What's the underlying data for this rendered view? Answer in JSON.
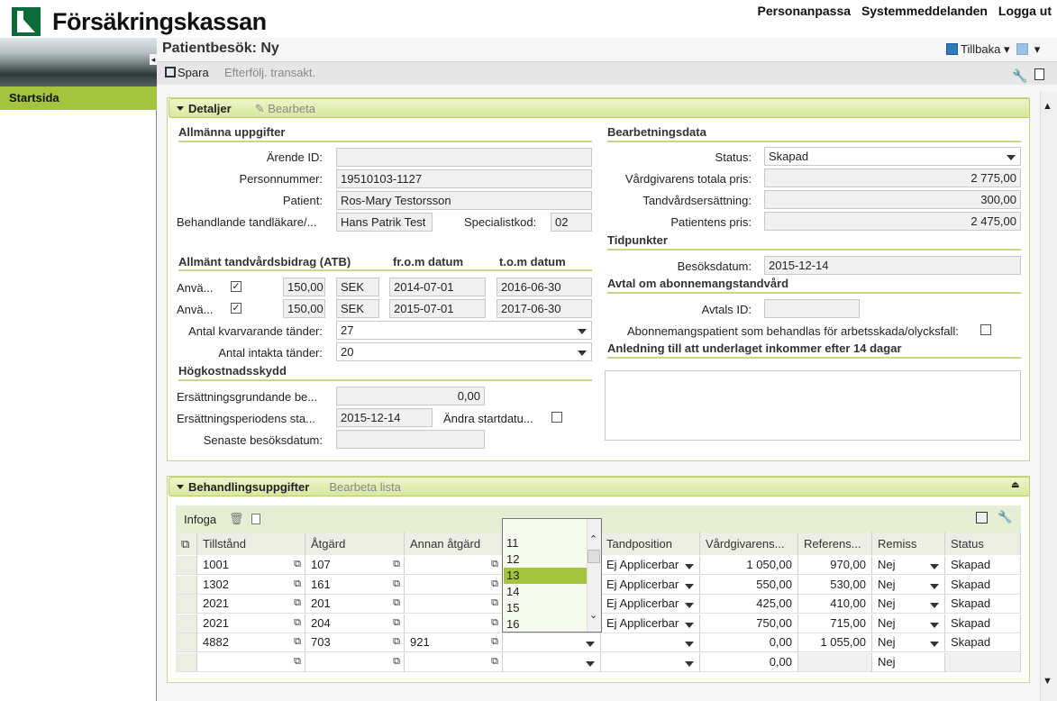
{
  "app": {
    "brand": "Försäkringskassan",
    "links": [
      "Personanpassa",
      "Systemmeddelanden",
      "Logga ut"
    ]
  },
  "nav": {
    "items": [
      {
        "label": "Startsida"
      }
    ]
  },
  "page": {
    "title": "Patientbesök: Ny",
    "back_label": "Tillbaka"
  },
  "toolbar": {
    "save_label": "Spara",
    "followup_label": "Efterfölj. transakt."
  },
  "details": {
    "header": "Detaljer",
    "edit_label": "Bearbeta",
    "general": {
      "title": "Allmänna uppgifter",
      "arende_label": "Ärende ID:",
      "arende_value": "",
      "pnr_label": "Personnummer:",
      "pnr_value": "19510103-1127",
      "patient_label": "Patient:",
      "patient_value": "Ros-Mary Testorsson",
      "dentist_label": "Behandlande tandläkare/...",
      "dentist_value": "Hans Patrik Test",
      "spec_label": "Specialistkod:",
      "spec_value": "02"
    },
    "atb": {
      "title": "Allmänt tandvårdsbidrag (ATB)",
      "from_header": "fr.o.m datum",
      "tom_header": "t.o.m datum",
      "rows": [
        {
          "label": "Anvä...",
          "checked": "✓",
          "amount": "150,00",
          "currency": "SEK",
          "from": "2014-07-01",
          "to": "2016-06-30"
        },
        {
          "label": "Anvä...",
          "checked": "✓",
          "amount": "150,00",
          "currency": "SEK",
          "from": "2015-07-01",
          "to": "2017-06-30"
        }
      ],
      "remaining_label": "Antal kvarvarande tänder:",
      "remaining_value": "27",
      "intact_label": "Antal intakta tänder:",
      "intact_value": "20"
    },
    "hks": {
      "title": "Högkostnadsskydd",
      "basis_label": "Ersättningsgrundande be...",
      "basis_value": "0,00",
      "period_label": "Ersättningsperiodens sta...",
      "period_value": "2015-12-14",
      "change_label": "Ändra startdatu...",
      "last_label": "Senaste besöksdatum:",
      "last_value": ""
    },
    "processing": {
      "title": "Bearbetningsdata",
      "status_label": "Status:",
      "status_value": "Skapad",
      "total_label": "Vårdgivarens totala pris:",
      "total_value": "2 775,00",
      "comp_label": "Tandvårdsersättning:",
      "comp_value": "300,00",
      "patient_label": "Patientens pris:",
      "patient_value": "2 475,00"
    },
    "times": {
      "title": "Tidpunkter",
      "visit_label": "Besöksdatum:",
      "visit_value": "2015-12-14"
    },
    "subscription": {
      "title": "Avtal om abonnemangstandvård",
      "id_label": "Avtals ID:",
      "id_value": "",
      "work_label": "Abonnemangspatient som behandlas för arbetsskada/olycksfall:"
    },
    "reason": {
      "title": "Anledning till att underlaget inkommer efter 14 dagar",
      "value": ""
    }
  },
  "treatments": {
    "header": "Behandlingsuppgifter",
    "edit_label": "Bearbeta lista",
    "insert_label": "Infoga",
    "columns": [
      "Tillstånd",
      "Åtgärd",
      "Annan åtgärd",
      "",
      "Tandposition",
      "Vårdgivarens...",
      "Referens...",
      "Remiss",
      "Status"
    ],
    "rows": [
      {
        "c": "1001",
        "a": "107",
        "o": "",
        "tp": "Ej Applicerbar",
        "p": "1 050,00",
        "r": "970,00",
        "rm": "Nej",
        "s": "Skapad"
      },
      {
        "c": "1302",
        "a": "161",
        "o": "",
        "tp": "Ej Applicerbar",
        "p": "550,00",
        "r": "530,00",
        "rm": "Nej",
        "s": "Skapad"
      },
      {
        "c": "2021",
        "a": "201",
        "o": "",
        "tp": "Ej Applicerbar",
        "p": "425,00",
        "r": "410,00",
        "rm": "Nej",
        "s": "Skapad"
      },
      {
        "c": "2021",
        "a": "204",
        "o": "",
        "tp": "Ej Applicerbar",
        "p": "750,00",
        "r": "715,00",
        "rm": "Nej",
        "s": "Skapad"
      },
      {
        "c": "4882",
        "a": "703",
        "o": "921",
        "tp": "",
        "p": "0,00",
        "r": "1 055,00",
        "rm": "Nej",
        "s": "Skapad"
      },
      {
        "c": "",
        "a": "",
        "o": "",
        "tp": "",
        "p": "0,00",
        "r": "",
        "rm": "Nej",
        "s": ""
      }
    ],
    "dropdown_options": [
      "11",
      "12",
      "13",
      "14",
      "15",
      "16"
    ],
    "dropdown_selected": "13"
  }
}
